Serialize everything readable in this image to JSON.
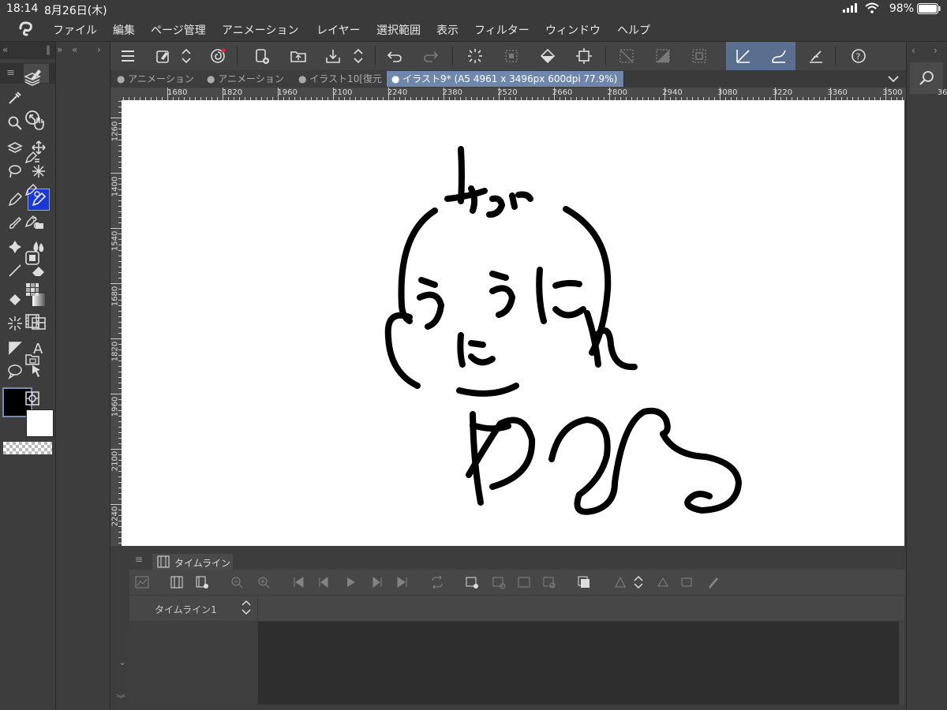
{
  "status_bar": {
    "time": "18:14",
    "date": "8月26日(木)",
    "battery": "98%"
  },
  "menu": {
    "items": [
      "ファイル",
      "編集",
      "ページ管理",
      "アニメーション",
      "レイヤー",
      "選択範囲",
      "表示",
      "フィルター",
      "ウィンドウ",
      "ヘルプ"
    ]
  },
  "tabs": [
    {
      "label": "アニメーション"
    },
    {
      "label": "アニメーション"
    },
    {
      "label": "イラスト10[復元"
    },
    {
      "label": "イラスト9* (A5 4961 x 3496px 600dpi 77.9%)"
    }
  ],
  "ruler": {
    "h_labels": [
      "1680",
      "1820",
      "1960",
      "2100",
      "2240",
      "2380",
      "2520",
      "2660",
      "2800",
      "2940",
      "3080",
      "3220",
      "3360",
      "3500",
      "3640"
    ],
    "v_labels": [
      "1260",
      "1400",
      "1540",
      "1680",
      "1820",
      "1960",
      "2100",
      "2240",
      "2380"
    ]
  },
  "timeline": {
    "tab_label": "タイムライン",
    "track_name": "タイムライン1"
  },
  "colors": {
    "main_color": "#000000",
    "sub_color": "#ffffff",
    "active_tab": "#6f87ab",
    "selected_tool": "#1a37d8",
    "active_cmd": "#5a6e8f"
  },
  "icons": {
    "command_bar": [
      "menu-icon",
      "new-file-icon",
      "quick-access-icon",
      "new-canvas-icon",
      "open-folder-icon",
      "save-icon",
      "undo-icon",
      "redo-icon",
      "clear-icon",
      "fill-selection-icon",
      "transform-icon",
      "select-all-icon",
      "deselect-icon",
      "invert-selection-icon",
      "ruler-snap-icon",
      "snap-stroke-icon",
      "fill-snap-icon",
      "help-icon"
    ]
  }
}
